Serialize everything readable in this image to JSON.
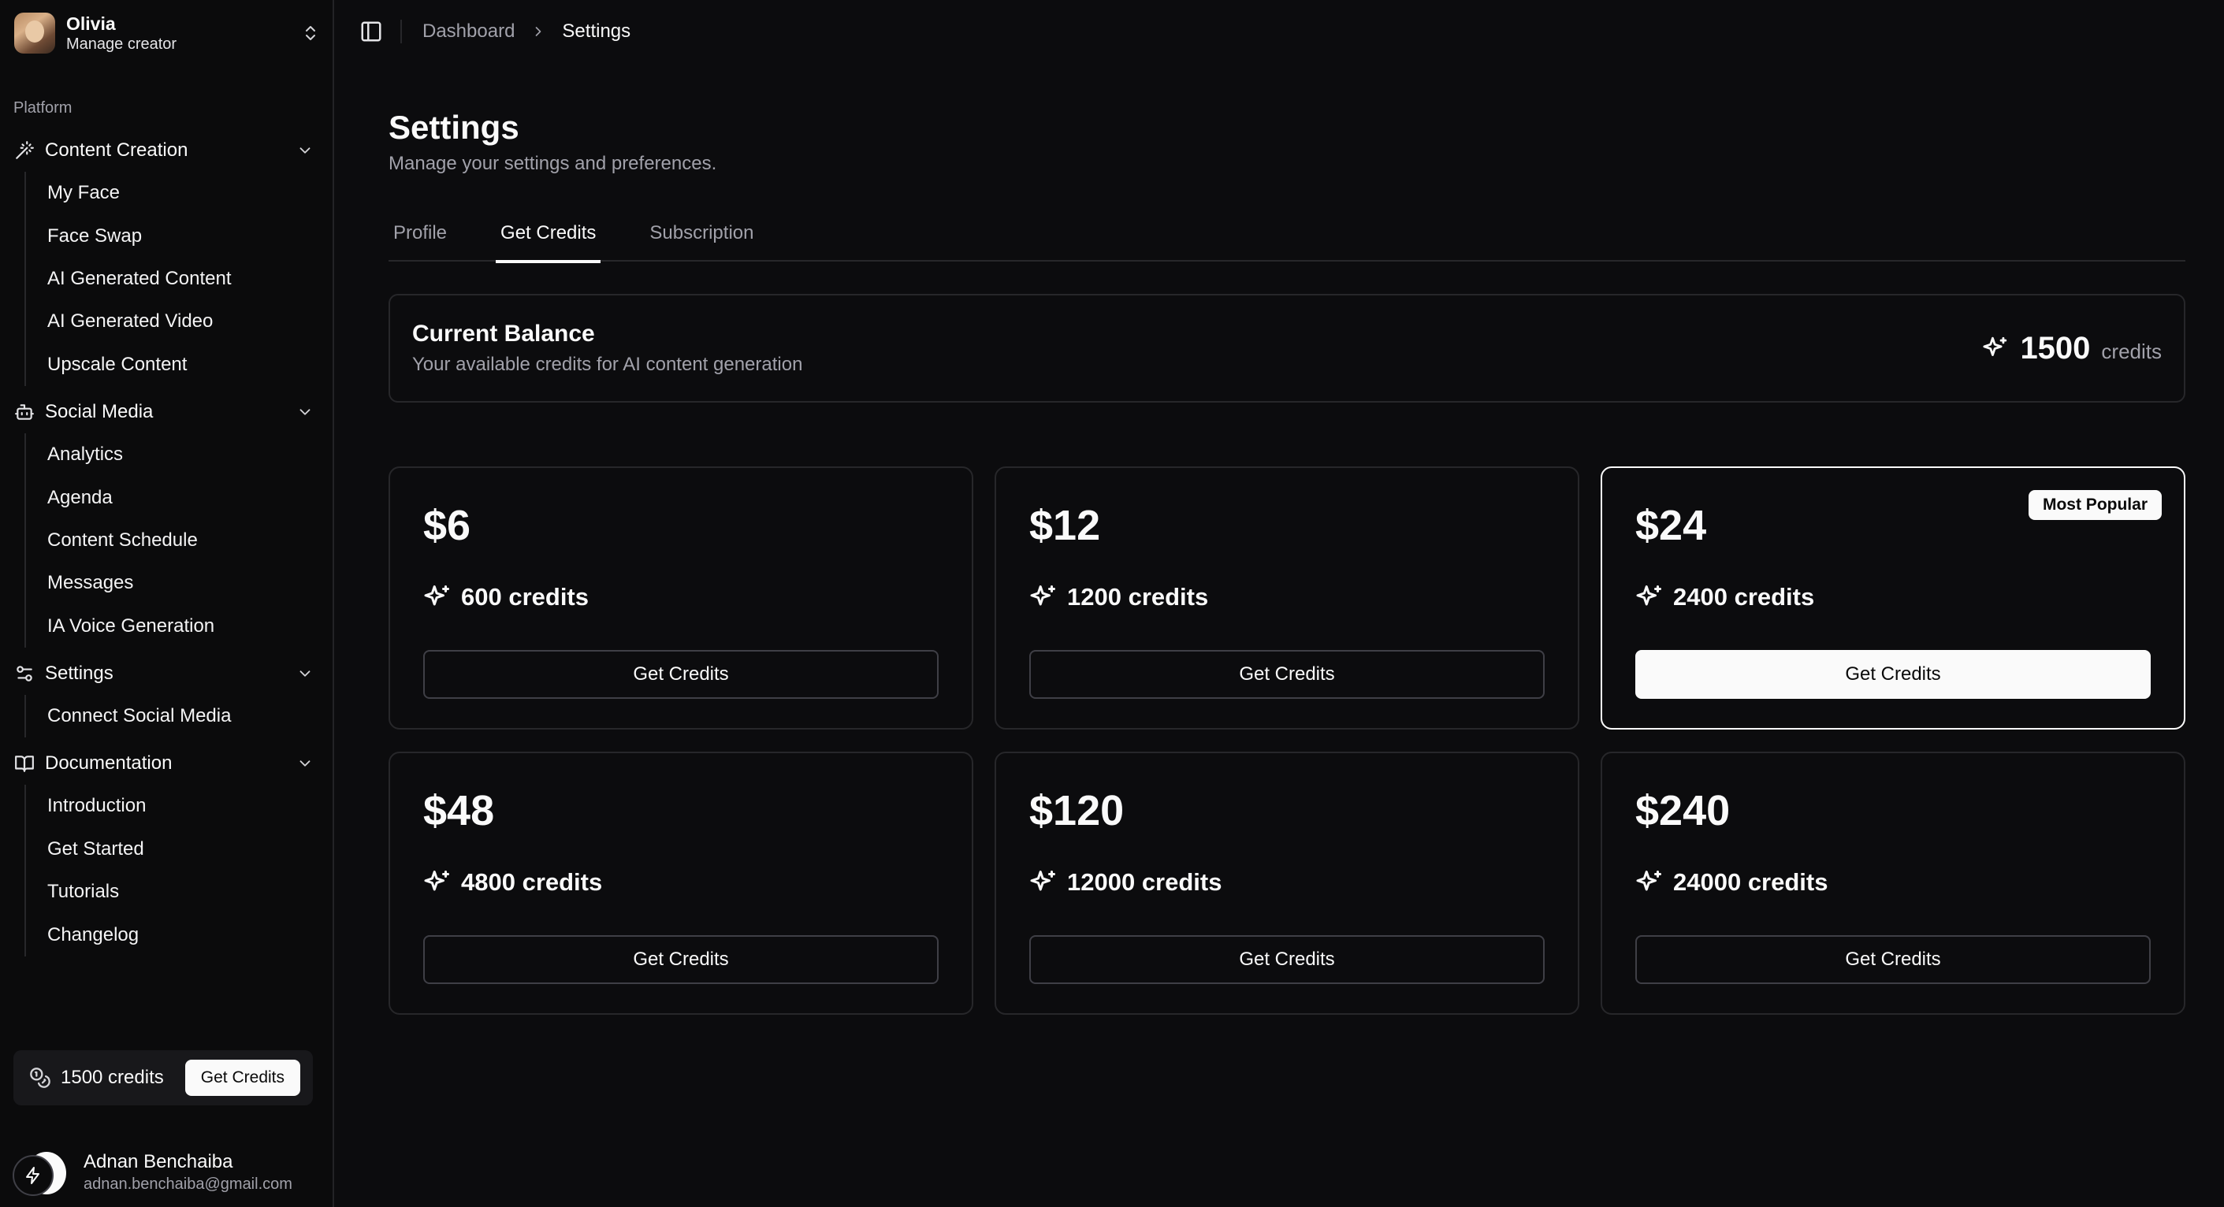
{
  "account": {
    "name": "Olivia",
    "role": "Manage creator"
  },
  "sidebar": {
    "section_label": "Platform",
    "groups": [
      {
        "label": "Content Creation",
        "icon": "wand-icon",
        "items": [
          "My Face",
          "Face Swap",
          "AI Generated Content",
          "AI Generated Video",
          "Upscale Content"
        ]
      },
      {
        "label": "Social Media",
        "icon": "bot-icon",
        "items": [
          "Analytics",
          "Agenda",
          "Content Schedule",
          "Messages",
          "IA Voice Generation"
        ]
      },
      {
        "label": "Settings",
        "icon": "settings-sliders-icon",
        "items": [
          "Connect Social Media"
        ]
      },
      {
        "label": "Documentation",
        "icon": "book-icon",
        "items": [
          "Introduction",
          "Get Started",
          "Tutorials",
          "Changelog"
        ]
      }
    ],
    "credits": {
      "label": "1500 credits",
      "button": "Get Credits"
    },
    "user": {
      "name": "Adnan Benchaiba",
      "email": "adnan.benchaiba@gmail.com"
    }
  },
  "breadcrumb": {
    "parent": "Dashboard",
    "current": "Settings"
  },
  "page": {
    "title": "Settings",
    "subtitle": "Manage your settings and preferences.",
    "tabs": [
      "Profile",
      "Get Credits",
      "Subscription"
    ],
    "active_tab": 1
  },
  "balance": {
    "title": "Current Balance",
    "subtitle": "Your available credits for AI content generation",
    "amount": "1500",
    "unit": "credits"
  },
  "packages": [
    {
      "price": "$6",
      "credits": "600 credits",
      "button": "Get Credits",
      "popular": false
    },
    {
      "price": "$12",
      "credits": "1200 credits",
      "button": "Get Credits",
      "popular": false
    },
    {
      "price": "$24",
      "credits": "2400 credits",
      "button": "Get Credits",
      "popular": true,
      "badge": "Most Popular"
    },
    {
      "price": "$48",
      "credits": "4800 credits",
      "button": "Get Credits",
      "popular": false
    },
    {
      "price": "$120",
      "credits": "12000 credits",
      "button": "Get Credits",
      "popular": false
    },
    {
      "price": "$240",
      "credits": "24000 credits",
      "button": "Get Credits",
      "popular": false
    }
  ],
  "colors": {
    "background": "#0c0c0e",
    "foreground": "#fafafa",
    "muted": "#a1a1aa",
    "border": "#27272a"
  }
}
